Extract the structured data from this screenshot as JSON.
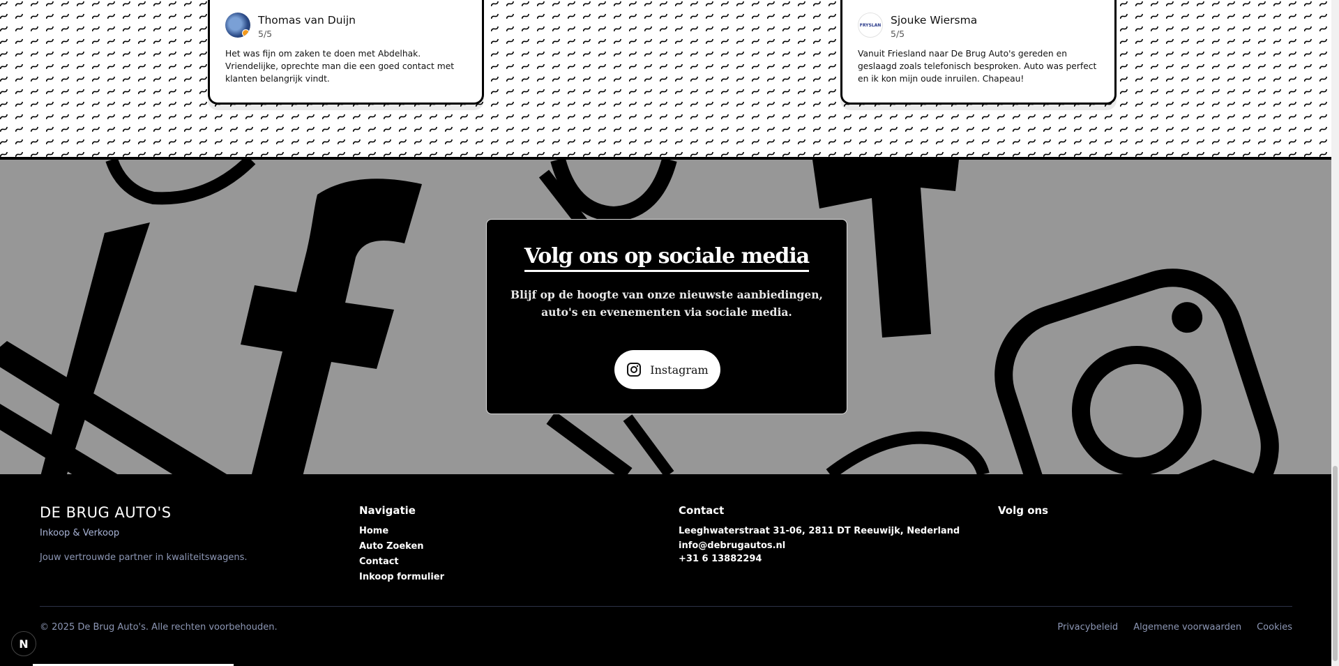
{
  "reviews": [
    {
      "name": "Thomas van Duijn",
      "rating": "5/5",
      "text": "Het was fijn om zaken te doen met Abdelhak. Vriendelijke, oprechte man die een goed contact met klanten belangrijk vindt.",
      "avatar": "profile-photo"
    },
    {
      "name": "Sjouke Wiersma",
      "rating": "5/5",
      "text": "Vanuit Friesland naar De Brug Auto's gereden en geslaagd zoals telefonisch besproken. Auto was perfect en ik kon mijn oude inruilen. Chapeau!",
      "avatar": "company-logo",
      "avatar_text": "FRYSLAN"
    }
  ],
  "social": {
    "title": "Volg ons op sociale media",
    "text": "Blijf op de hoogte van onze nieuwste aanbiedingen, auto's en evenementen via sociale media.",
    "button_label": "Instagram",
    "button_icon": "instagram-icon"
  },
  "footer": {
    "brand": "DE BRUG AUTO'S",
    "brand_sub": "Inkoop & Verkoop",
    "tagline": "Jouw vertrouwde partner in kwaliteitswagens.",
    "nav_heading": "Navigatie",
    "nav_links": [
      "Home",
      "Auto Zoeken",
      "Contact",
      "Inkoop formulier"
    ],
    "contact_heading": "Contact",
    "address": "Leeghwaterstraat 31-06, 2811 DT Reeuwijk, Nederland",
    "email": "info@debrugautos.nl",
    "phone": "+31 6 13882294",
    "follow_heading": "Volg ons",
    "copyright": "© 2025 De Brug Auto's. Alle rechten voorbehouden.",
    "legal_links": [
      "Privacybeleid",
      "Algemene voorwaarden",
      "Cookies"
    ]
  },
  "dev_badge": "N",
  "colors": {
    "social_bg": "#979797",
    "footer_bg": "#000000",
    "muted_text": "#8d97b5"
  }
}
